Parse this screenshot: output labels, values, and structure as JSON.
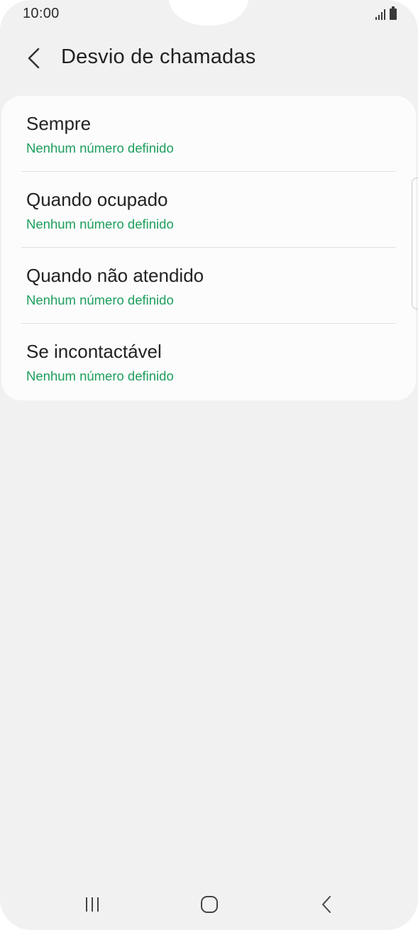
{
  "status_bar": {
    "time": "10:00",
    "icons": [
      "signal-icon",
      "battery-icon"
    ]
  },
  "header": {
    "title": "Desvio de chamadas",
    "back_icon": "chevron-left-icon"
  },
  "list": {
    "items": [
      {
        "title": "Sempre",
        "subtitle": "Nenhum número definido"
      },
      {
        "title": "Quando ocupado",
        "subtitle": "Nenhum número definido"
      },
      {
        "title": "Quando não atendido",
        "subtitle": "Nenhum número definido"
      },
      {
        "title": "Se incontactável",
        "subtitle": "Nenhum número definido"
      }
    ]
  },
  "nav_bar": {
    "buttons": [
      "recent-apps-icon",
      "home-icon",
      "back-icon"
    ]
  },
  "colors": {
    "background": "#f1f1f1",
    "card": "#fcfcfc",
    "accent_green": "#1c9e5c",
    "text": "#222222"
  }
}
